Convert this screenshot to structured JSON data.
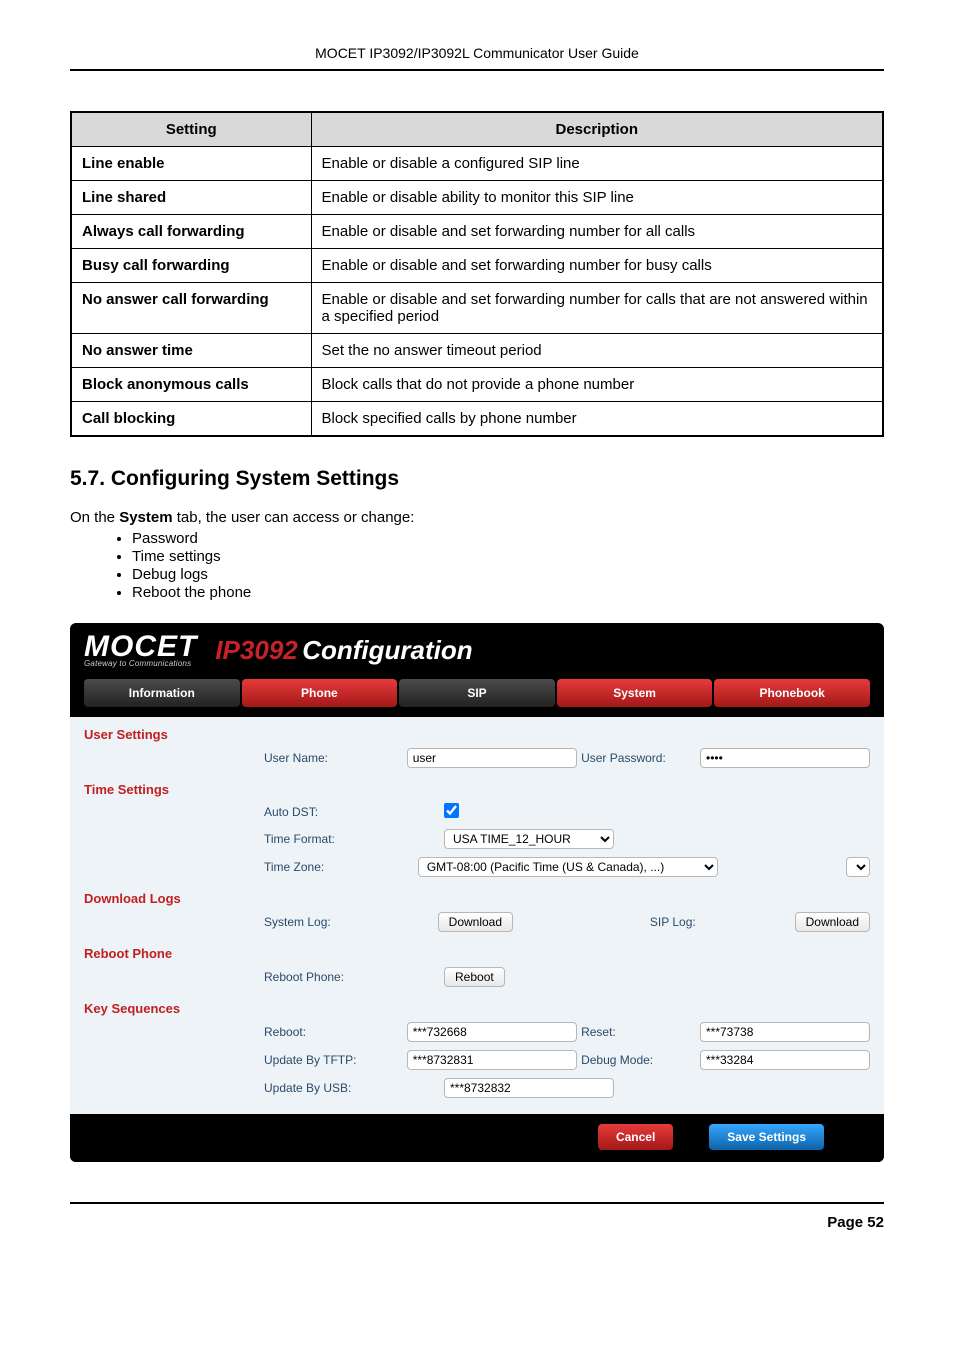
{
  "doc_header": "MOCET IP3092/IP3092L Communicator User Guide",
  "table": {
    "h1": "Setting",
    "h2": "Description",
    "rows": [
      {
        "s": "Line enable",
        "d": "Enable or disable a configured SIP line"
      },
      {
        "s": "Line shared",
        "d": "Enable or disable ability to monitor this SIP line"
      },
      {
        "s": "Always call forwarding",
        "d": "Enable or disable and set forwarding number for all calls"
      },
      {
        "s": "Busy call forwarding",
        "d": "Enable or disable and set forwarding number for busy calls"
      },
      {
        "s": "No answer call forwarding",
        "d": "Enable or disable and set forwarding number for calls that are not answered within a specified period"
      },
      {
        "s": "No answer time",
        "d": "Set the no answer timeout period"
      },
      {
        "s": "Block anonymous calls",
        "d": "Block calls that do not provide a phone number"
      },
      {
        "s": "Call blocking",
        "d": "Block specified calls by phone number"
      }
    ]
  },
  "section_title": "5.7. Configuring System Settings",
  "intro_prefix": "On the ",
  "intro_bold": "System",
  "intro_suffix": " tab, the user can access or change:",
  "bullets": [
    "Password",
    "Time settings",
    "Debug logs",
    "Reboot the phone"
  ],
  "logo": {
    "main": "MOCET",
    "sub": "Gateway to Communications"
  },
  "brand": {
    "model": "IP3092",
    "conf": "Configuration"
  },
  "tabs": [
    "Information",
    "Phone",
    "SIP",
    "System",
    "Phonebook"
  ],
  "cfg": {
    "user_settings": {
      "title": "User Settings",
      "namelbl": "User Name:",
      "nameval": "user",
      "pwdlbl": "User Password:",
      "pwdval": "••••"
    },
    "time_settings": {
      "title": "Time Settings",
      "dstlbl": "Auto DST:",
      "tflbl": "Time Format:",
      "tfval": "USA TIME_12_HOUR",
      "tzlbl": "Time Zone:",
      "tzval": "GMT-08:00 (Pacific Time (US & Canada), ...)"
    },
    "download_logs": {
      "title": "Download Logs",
      "syslbl": "System Log:",
      "sysbtn": "Download",
      "siplbl": "SIP Log:",
      "sipbtn": "Download"
    },
    "reboot_phone": {
      "title": "Reboot Phone",
      "lbl": "Reboot Phone:",
      "btn": "Reboot"
    },
    "key_sequences": {
      "title": "Key Sequences",
      "rebootlbl": "Reboot:",
      "rebootval": "***732668",
      "resetlbl": "Reset:",
      "resetval": "***73738",
      "tftplbl": "Update By TFTP:",
      "tftpval": "***8732831",
      "debuglbl": "Debug Mode:",
      "debugval": "***33284",
      "usblbl": "Update By USB:",
      "usbval": "***8732832"
    }
  },
  "footer": {
    "cancel": "Cancel",
    "save": "Save Settings"
  },
  "pagefoot": "Page 52"
}
